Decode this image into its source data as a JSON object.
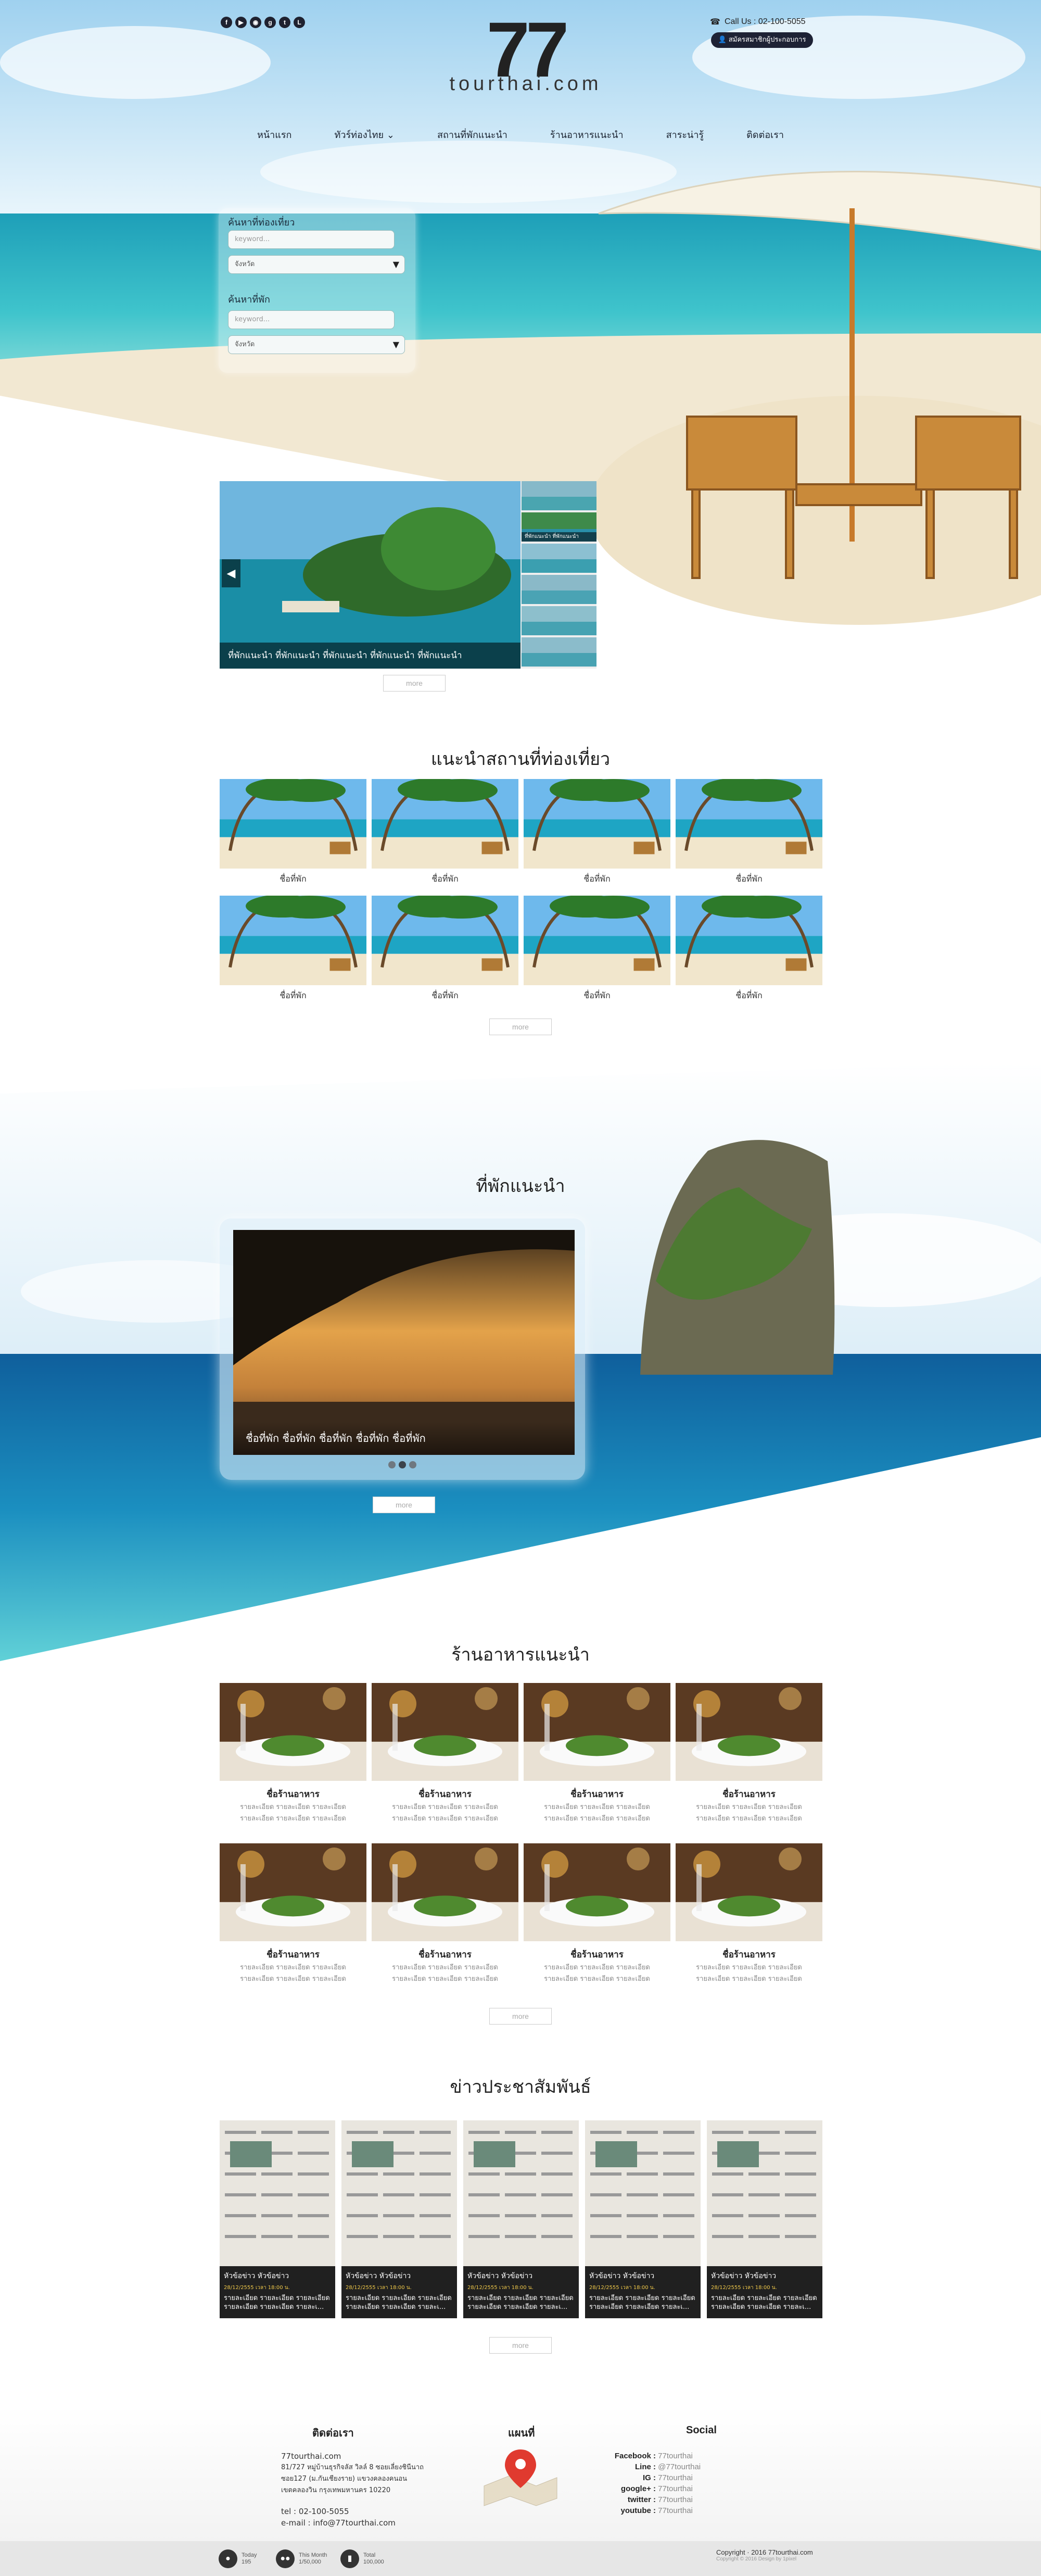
{
  "header": {
    "social_icons": [
      "facebook-icon",
      "youtube-icon",
      "instagram-icon",
      "google-plus-icon",
      "twitter-icon",
      "line-icon"
    ],
    "logo_number": "77",
    "logo_text": "tourthai.com",
    "call_label": "Call Us : 02-100-5055",
    "register_button": "สมัครสมาชิกผู้ประกอบการ"
  },
  "nav": {
    "items": [
      "หน้าแรก",
      "ทัวร์ท่องไทย",
      "สถานที่พักแนะนำ",
      "ร้านอาหารแนะนำ",
      "สาระน่ารู้",
      "ติดต่อเรา"
    ]
  },
  "search": {
    "attraction_label": "ค้นหาที่ท่องเที่ยว",
    "attraction_placeholder": "keyword...",
    "attraction_province": "จังหวัด",
    "hotel_label": "ค้นหาที่พัก",
    "hotel_placeholder": "keyword...",
    "hotel_province": "จังหวัด"
  },
  "gallery": {
    "caption": "ที่พักแนะนำ ที่พักแนะนำ ที่พักแนะนำ ที่พักแนะนำ ที่พักแนะนำ",
    "thumb_caption": "ที่พักแนะนำ ที่พักแนะนำ",
    "more": "more"
  },
  "attractions": {
    "title": "แนะนำสถานที่ท่องเที่ยว",
    "item_caption": "ชื่อที่พัก",
    "more": "more"
  },
  "resorts": {
    "title": "ที่พักแนะนำ",
    "caption": "ชื่อที่พัก ชื่อที่พัก ชื่อที่พัก ชื่อที่พัก ชื่อที่พัก",
    "more": "more"
  },
  "restaurants": {
    "title": "ร้านอาหารแนะนำ",
    "item_title": "ชื่อร้านอาหาร",
    "item_desc_1": "รายละเอียด รายละเอียด รายละเอียด",
    "item_desc_2": "รายละเอียด รายละเอียด รายละเอียด",
    "more": "more"
  },
  "news": {
    "title": "ข่าวประชาสัมพันธ์",
    "item_title": "หัวข้อข่าว หัวข้อข่าว",
    "item_date": "28/12/2555 เวลา 18:00 น.",
    "item_text": "รายละเอียด รายละเอียด รายละเอียด รายละเอียด รายละเอียด รายละเ...",
    "more": "more"
  },
  "footer": {
    "contact_title": "ติดต่อเรา",
    "company": "77tourthai.com",
    "address_1": "81/727 หมู่บ้านธุรกิจลัส วิลล์ 8 ซอยเลี่ยงชินีนาถ",
    "address_2": "ซอย127 (ม.กันเชียงราย) แขวงคลองคนอน",
    "address_3": "เขตคลองวิน กรุงเทพมหานคร 10220",
    "tel": "tel : 02-100-5055",
    "email": "e-mail : info@77tourthai.com",
    "map_title": "แผนที่",
    "social_title": "Social",
    "social": [
      {
        "k": "Facebook :",
        "v": "77tourthai"
      },
      {
        "k": "Line :",
        "v": "@77tourthai"
      },
      {
        "k": "IG :",
        "v": "77tourthai"
      },
      {
        "k": "google+ :",
        "v": "77tourthai"
      },
      {
        "k": "twitter :",
        "v": "77tourthai"
      },
      {
        "k": "youtube :",
        "v": "77tourthai"
      }
    ],
    "stats": [
      {
        "label": "Today",
        "value": "195"
      },
      {
        "label": "This Month",
        "value": "1/50,000"
      },
      {
        "label": "Total",
        "value": "100,000"
      }
    ],
    "copyright": "Copyright · 2016 77tourthai.com",
    "copyright_sub": "Copyright © 2016 Design by 1pixel"
  },
  "colors": {
    "dark": "#1e2235",
    "sea": "#2fb5c8",
    "sky": "#a8d8f0",
    "pin": "#e03a2f"
  }
}
